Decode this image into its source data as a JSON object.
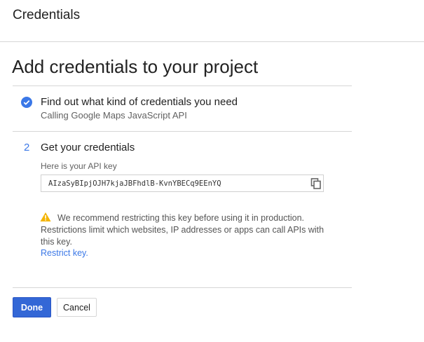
{
  "header": {
    "title": "Credentials"
  },
  "page": {
    "title": "Add credentials to your project"
  },
  "steps": [
    {
      "status": "complete",
      "icon": "check-circle-icon",
      "title": "Find out what kind of credentials you need",
      "subtitle": "Calling Google Maps JavaScript API"
    },
    {
      "number": "2",
      "title": "Get your credentials",
      "field_label": "Here is your API key",
      "api_key": "AIzaSyBIpjOJH7kjaJBFhdlB-KvnYBECq9EEnYQ"
    }
  ],
  "warning": {
    "icon": "warning-icon",
    "text": "We recommend restricting this key before using it in production. Restrictions limit which websites, IP addresses or apps can call APIs with this key.",
    "link": "Restrict key."
  },
  "actions": {
    "done": "Done",
    "cancel": "Cancel"
  },
  "colors": {
    "accent": "#3b78e7",
    "primary_button": "#3367d6",
    "warning": "#f4b400"
  }
}
